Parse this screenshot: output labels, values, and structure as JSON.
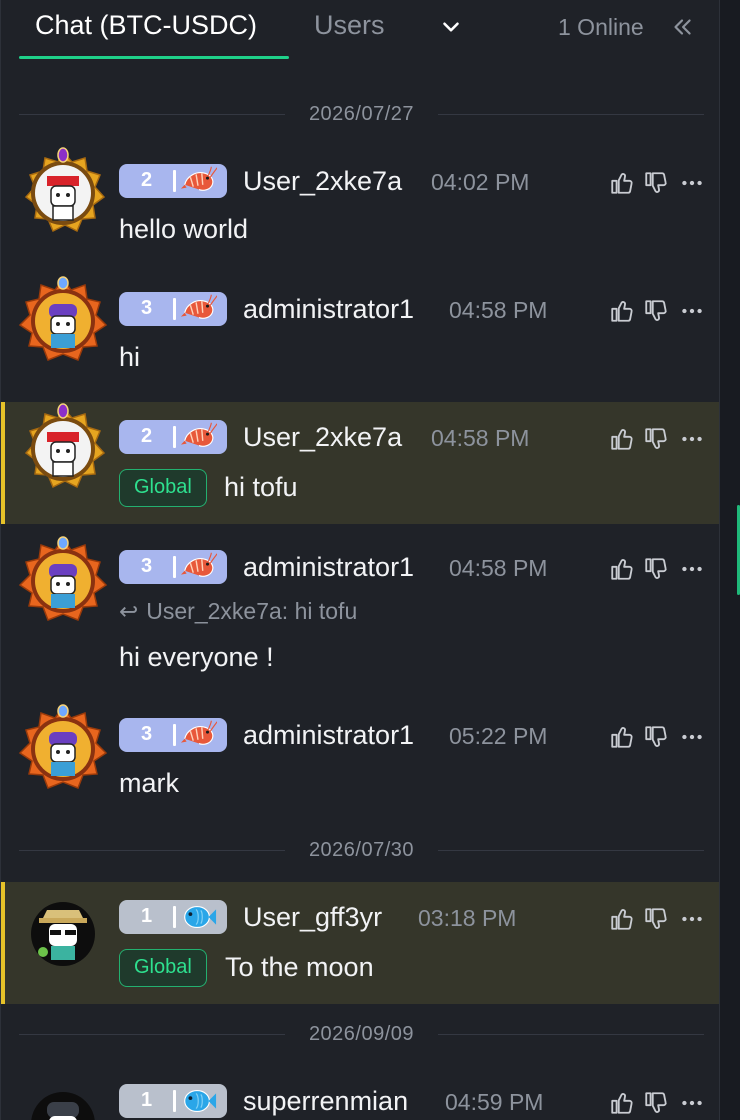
{
  "header": {
    "tabs": [
      {
        "label": "Chat (BTC-USDC)",
        "active": true
      },
      {
        "label": "Users",
        "active": false
      }
    ],
    "online_text": "1 Online",
    "icons": {
      "dropdown": "chevron-down-icon",
      "collapse": "double-chevron-left-icon"
    },
    "accent_color": "#1fd18a"
  },
  "dates": [
    "2026/07/27",
    "2026/07/30",
    "2026/09/09"
  ],
  "messages": [
    {
      "level": "2",
      "username": "User_2xke7a",
      "time": "04:02 PM",
      "text": "hello world",
      "avatar": "ninja-avatar-gold-frame",
      "pet": "shrimp-icon",
      "highlighted": false
    },
    {
      "level": "3",
      "username": "administrator1",
      "time": "04:58 PM",
      "text": "hi",
      "avatar": "purple-hat-avatar-orange-frame",
      "pet": "shrimp-icon",
      "highlighted": false
    },
    {
      "level": "2",
      "username": "User_2xke7a",
      "time": "04:58 PM",
      "tag": "Global",
      "text": "hi tofu",
      "avatar": "ninja-avatar-gold-frame",
      "pet": "shrimp-icon",
      "highlighted": true
    },
    {
      "level": "3",
      "username": "administrator1",
      "time": "04:58 PM",
      "reply_to": "User_2xke7a: hi tofu",
      "text": "hi everyone !",
      "avatar": "purple-hat-avatar-orange-frame",
      "pet": "shrimp-icon",
      "highlighted": false
    },
    {
      "level": "3",
      "username": "administrator1",
      "time": "05:22 PM",
      "text": "mark",
      "avatar": "purple-hat-avatar-orange-frame",
      "pet": "shrimp-icon",
      "highlighted": false
    },
    {
      "level": "1",
      "username": "User_gff3yr",
      "time": "03:18 PM",
      "tag": "Global",
      "text": "To the moon",
      "avatar": "sunglasses-avatar",
      "pet": "fish-icon",
      "highlighted": true
    },
    {
      "level": "1",
      "username": "superrenmian",
      "time": "04:59 PM",
      "text": "",
      "avatar": "beanie-avatar",
      "pet": "fish-icon",
      "highlighted": false
    }
  ],
  "colors": {
    "highlight_bar": "#e6c229",
    "global_tag": "#2ee08f",
    "badge_purple": "#a8b6ee",
    "badge_grey": "#b9c0cc"
  }
}
